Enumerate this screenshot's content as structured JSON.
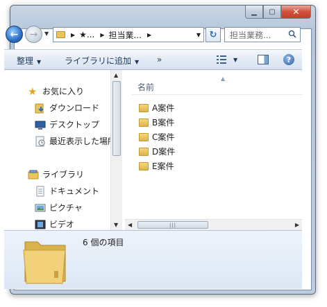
{
  "address": {
    "seg_star": "★...",
    "seg_folder": "担当業..."
  },
  "search": {
    "placeholder": "担当業務..."
  },
  "toolbar": {
    "organize": "整理",
    "include_library": "ライブラリに追加",
    "more": "»"
  },
  "nav": {
    "favorites": "お気に入り",
    "favorites_items": [
      "ダウンロード",
      "デスクトップ",
      "最近表示した場所"
    ],
    "libraries": "ライブラリ",
    "libraries_items": [
      "ドキュメント",
      "ピクチャ",
      "ビデオ"
    ]
  },
  "files": {
    "column_name": "名前",
    "items": [
      "A案件",
      "B案件",
      "C案件",
      "D案件",
      "E案件"
    ]
  },
  "details": {
    "count": "6 個の項目"
  },
  "icons": {
    "back": "back-arrow-icon",
    "forward": "forward-arrow-icon",
    "refresh": "refresh-icon",
    "search": "search-icon",
    "folder": "folder-icon"
  },
  "colors": {
    "accent": "#2b6fc4",
    "close": "#c4402a",
    "folder": "#e8c65a"
  }
}
